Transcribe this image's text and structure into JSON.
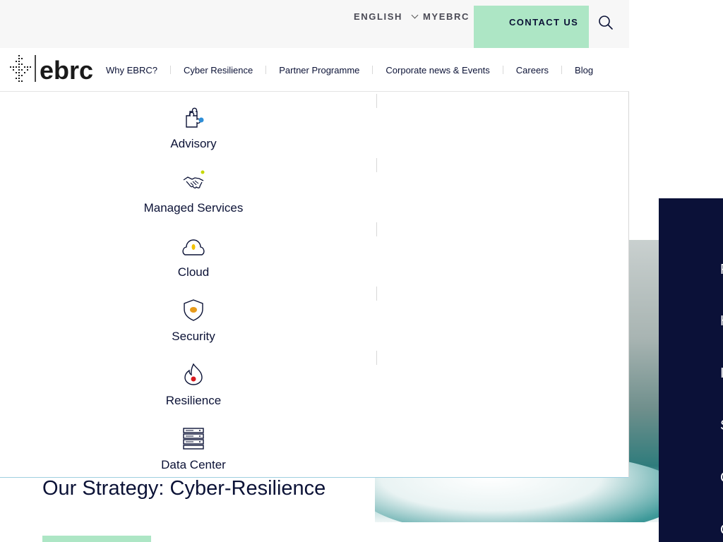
{
  "topbar": {
    "language": "ENGLISH",
    "myebrc": "MYEBRC",
    "contact": "CONTACT US",
    "search_icon": "search-icon"
  },
  "brand": {
    "logo_text": "ebrc"
  },
  "nav": {
    "items": [
      {
        "label": "Why EBRC?"
      },
      {
        "label": "Cyber Resilience"
      },
      {
        "label": "Partner Programme"
      },
      {
        "label": "Corporate news & Events"
      },
      {
        "label": "Careers"
      },
      {
        "label": "Blog"
      }
    ]
  },
  "mega_menu": {
    "services": [
      {
        "label": "Advisory",
        "icon": "puzzle-icon",
        "accent": "#2f8fd8"
      },
      {
        "label": "Managed Services",
        "icon": "handshake-icon",
        "accent": "#c7d800"
      },
      {
        "label": "Cloud",
        "icon": "cloud-icon",
        "accent": "#f2c200"
      },
      {
        "label": "Security",
        "icon": "shield-icon",
        "accent": "#e89b1a"
      },
      {
        "label": "Resilience",
        "icon": "flame-icon",
        "accent": "#d7191f"
      },
      {
        "label": "Data Center",
        "icon": "server-icon",
        "accent": "#0b1236"
      }
    ]
  },
  "content": {
    "strategy_heading": "Our Strategy: Cyber-Resilience",
    "side_panel_letters": [
      "F",
      "H",
      "I",
      "S",
      "C",
      "C"
    ]
  },
  "colors": {
    "navy": "#0b1236",
    "mint": "#ade6c5",
    "topbar_bg": "#f7f7f7"
  }
}
